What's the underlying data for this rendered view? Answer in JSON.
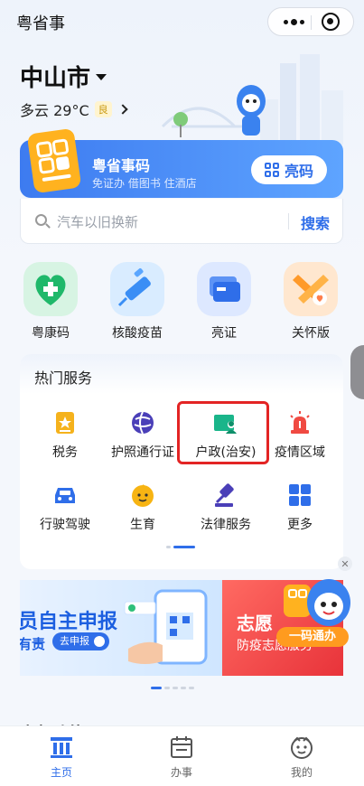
{
  "app": {
    "title": "粤省事"
  },
  "location": {
    "city": "中山市",
    "weather": "多云 29°C",
    "aqi": "良"
  },
  "code_card": {
    "title": "粤省事码",
    "subtitle": "免证办 借图书 住酒店",
    "button": "亮码"
  },
  "search": {
    "placeholder": "汽车以旧换新",
    "button": "搜索"
  },
  "quick_tiles": [
    {
      "label": "粤康码",
      "icon": "health-heart-icon"
    },
    {
      "label": "核酸疫苗",
      "icon": "syringe-icon"
    },
    {
      "label": "亮证",
      "icon": "certificate-cards-icon"
    },
    {
      "label": "关怀版",
      "icon": "care-ribbon-icon"
    }
  ],
  "hot_services": {
    "title": "热门服务",
    "items": [
      {
        "label": "税务",
        "icon": "tax-star-icon"
      },
      {
        "label": "护照通行证",
        "icon": "globe-passport-icon"
      },
      {
        "label": "户政(治安)",
        "icon": "id-card-person-icon"
      },
      {
        "label": "疫情区域",
        "icon": "alarm-siren-icon"
      },
      {
        "label": "行驶驾驶",
        "icon": "car-icon"
      },
      {
        "label": "生育",
        "icon": "baby-face-icon"
      },
      {
        "label": "法律服务",
        "icon": "gavel-icon"
      },
      {
        "label": "更多",
        "icon": "grid-more-icon"
      }
    ]
  },
  "banners": [
    {
      "title": "员自主申报",
      "subtitle": "有责",
      "button": "去申报"
    },
    {
      "title": "志愿",
      "subtitle": "防疫志愿服务",
      "tag": "一码通办"
    }
  ],
  "section_peek": "高频功能",
  "tabbar": [
    {
      "label": "主页",
      "icon": "home-icon",
      "active": true
    },
    {
      "label": "办事",
      "icon": "calendar-icon",
      "active": false
    },
    {
      "label": "我的",
      "icon": "profile-face-icon",
      "active": false
    }
  ],
  "colors": {
    "accent": "#2f6ee9",
    "highlight_box": "#e32424"
  }
}
